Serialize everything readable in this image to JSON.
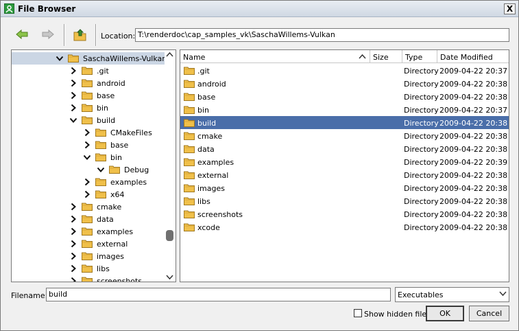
{
  "window": {
    "title": "File Browser",
    "close_glyph": "X"
  },
  "toolbar": {
    "back_icon": "arrow-left-icon",
    "forward_icon": "arrow-right-icon",
    "up_icon": "folder-up-icon",
    "location_label": "Location:",
    "location_value": "T:\\renderdoc\\cap_samples_vk\\SaschaWillems-Vulkan"
  },
  "tree": {
    "items": [
      {
        "label": "SaschaWillems-Vulkan",
        "expanded": true,
        "selected": true
      },
      {
        "label": ".git",
        "expanded": false
      },
      {
        "label": "android",
        "expanded": false
      },
      {
        "label": "base",
        "expanded": false
      },
      {
        "label": "bin",
        "expanded": false
      },
      {
        "label": "build",
        "expanded": true
      },
      {
        "label": "CMakeFiles",
        "expanded": false
      },
      {
        "label": "base",
        "expanded": false
      },
      {
        "label": "bin",
        "expanded": true
      },
      {
        "label": "Debug",
        "expanded": true
      },
      {
        "label": "examples",
        "expanded": false
      },
      {
        "label": "x64",
        "expanded": false
      },
      {
        "label": "cmake",
        "expanded": false
      },
      {
        "label": "data",
        "expanded": false
      },
      {
        "label": "examples",
        "expanded": false
      },
      {
        "label": "external",
        "expanded": false
      },
      {
        "label": "images",
        "expanded": false
      },
      {
        "label": "libs",
        "expanded": false
      },
      {
        "label": "screenshots",
        "expanded": false
      }
    ]
  },
  "list": {
    "columns": {
      "name": "Name",
      "size": "Size",
      "type": "Type",
      "modified": "Date Modified"
    },
    "rows": [
      {
        "name": ".git",
        "size": "",
        "type": "Directory",
        "modified": "2009-04-22 20:37"
      },
      {
        "name": "android",
        "size": "",
        "type": "Directory",
        "modified": "2009-04-22 20:38"
      },
      {
        "name": "base",
        "size": "",
        "type": "Directory",
        "modified": "2009-04-22 20:38"
      },
      {
        "name": "bin",
        "size": "",
        "type": "Directory",
        "modified": "2009-04-22 20:37"
      },
      {
        "name": "build",
        "size": "",
        "type": "Directory",
        "modified": "2009-04-22 20:38",
        "selected": true
      },
      {
        "name": "cmake",
        "size": "",
        "type": "Directory",
        "modified": "2009-04-22 20:38"
      },
      {
        "name": "data",
        "size": "",
        "type": "Directory",
        "modified": "2009-04-22 20:38"
      },
      {
        "name": "examples",
        "size": "",
        "type": "Directory",
        "modified": "2009-04-22 20:39"
      },
      {
        "name": "external",
        "size": "",
        "type": "Directory",
        "modified": "2009-04-22 20:38"
      },
      {
        "name": "images",
        "size": "",
        "type": "Directory",
        "modified": "2009-04-22 20:38"
      },
      {
        "name": "libs",
        "size": "",
        "type": "Directory",
        "modified": "2009-04-22 20:38"
      },
      {
        "name": "screenshots",
        "size": "",
        "type": "Directory",
        "modified": "2009-04-22 20:38"
      },
      {
        "name": "xcode",
        "size": "",
        "type": "Directory",
        "modified": "2009-04-22 20:38"
      }
    ]
  },
  "footer": {
    "filename_label": "Filename:",
    "filename_value": "build",
    "filter_value": "Executables",
    "show_hidden_label": "Show hidden files",
    "show_hidden_checked": false,
    "ok_label": "OK",
    "cancel_label": "Cancel"
  },
  "colors": {
    "selection": "#4a6ea9",
    "tree_selection": "#cbd6e4",
    "folder": "#f0c04a"
  }
}
